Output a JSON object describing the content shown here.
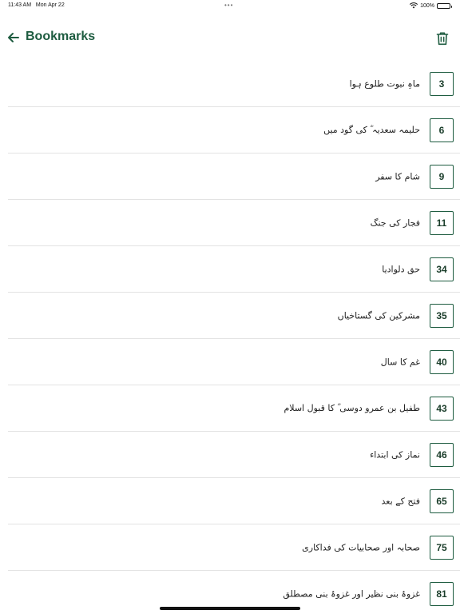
{
  "status_bar": {
    "time": "11:43 AM",
    "date": "Mon Apr 22",
    "dots": "•••",
    "battery": "100%",
    "battery_level": 1.0
  },
  "header": {
    "title": "Bookmarks",
    "back_icon": "arrow-left-icon",
    "trash_icon": "trash-icon",
    "accent_color": "#1e5c40"
  },
  "bookmarks": [
    {
      "page": "3",
      "title": "ماہِ نبوت طلوع ہوا"
    },
    {
      "page": "6",
      "title": "حلیمہ سعدیہ ؓ کی گود میں"
    },
    {
      "page": "9",
      "title": "شام کا سفر"
    },
    {
      "page": "11",
      "title": "فجار کی جنگ"
    },
    {
      "page": "34",
      "title": "حق دلوادیا"
    },
    {
      "page": "35",
      "title": "مشرکین کی گستاخیاں"
    },
    {
      "page": "40",
      "title": "غم کا سال"
    },
    {
      "page": "43",
      "title": "طفیل بن عمرو دوسی ؓ کا قبول اسلام"
    },
    {
      "page": "46",
      "title": "نماز کی ابتداء"
    },
    {
      "page": "65",
      "title": "فتح کے بعد"
    },
    {
      "page": "75",
      "title": "صحابہ اور صحابیات کی فداکاری"
    },
    {
      "page": "81",
      "title": "غزوۂ بنی نظیر اور غزوۂ بنی مصطلق"
    }
  ]
}
